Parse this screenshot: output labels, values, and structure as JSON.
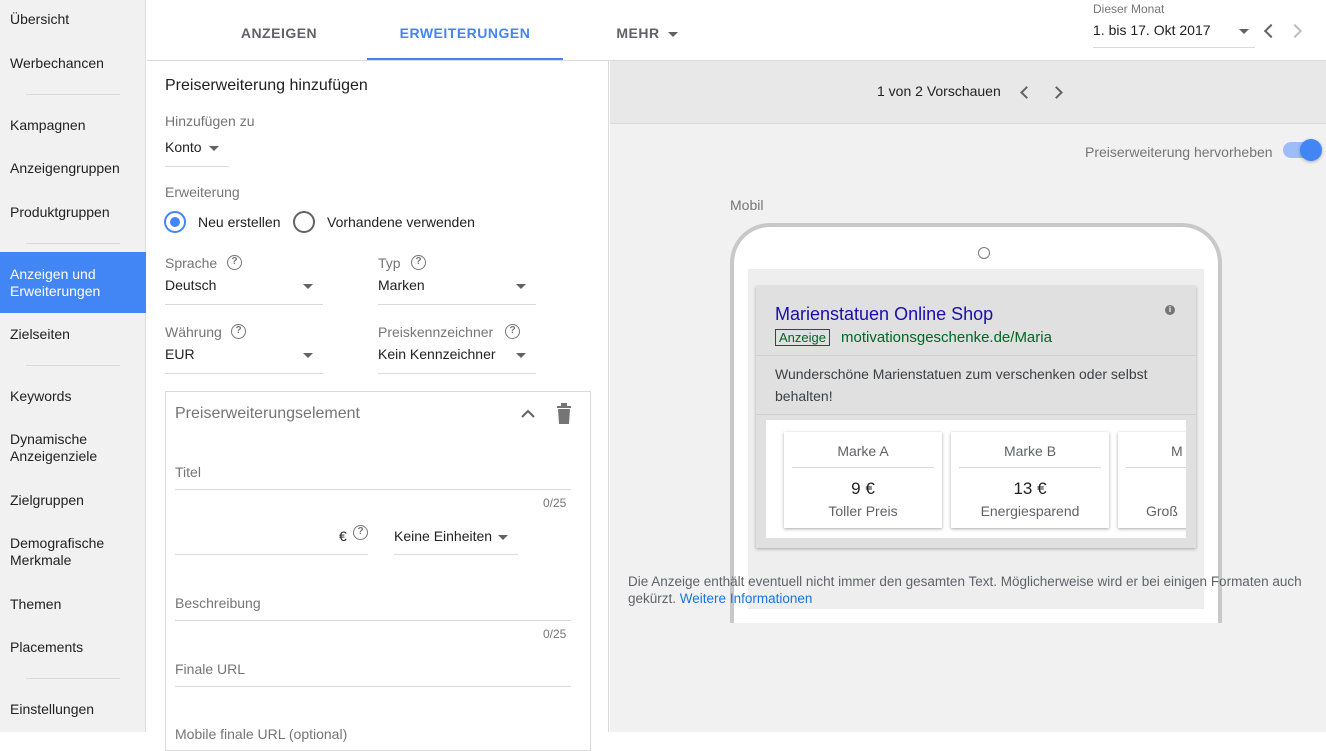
{
  "sidebar": {
    "items": [
      {
        "label": "Übersicht"
      },
      {
        "label": "Werbechancen"
      },
      {
        "label": "Kampagnen"
      },
      {
        "label": "Anzeigengruppen"
      },
      {
        "label": "Produktgruppen"
      },
      {
        "label": "Anzeigen und Erweiterungen",
        "active": true
      },
      {
        "label": "Zielseiten"
      },
      {
        "label": "Keywords"
      },
      {
        "label": "Dynamische Anzeigenziele"
      },
      {
        "label": "Zielgruppen"
      },
      {
        "label": "Demografische Merkmale"
      },
      {
        "label": "Themen"
      },
      {
        "label": "Placements"
      },
      {
        "label": "Einstellungen"
      }
    ]
  },
  "tabs": {
    "anzeigen": "ANZEIGEN",
    "erweiterungen": "ERWEITERUNGEN",
    "mehr": "MEHR"
  },
  "date_range": {
    "label": "Dieser Monat",
    "value": "1. bis 17. Okt 2017"
  },
  "form": {
    "title": "Preiserweiterung hinzufügen",
    "add_to_label": "Hinzufügen zu",
    "add_to_value": "Konto",
    "extension_label": "Erweiterung",
    "radio_new": "Neu erstellen",
    "radio_existing": "Vorhandene verwenden",
    "language_label": "Sprache",
    "language_value": "Deutsch",
    "type_label": "Typ",
    "type_value": "Marken",
    "currency_label": "Währung",
    "currency_value": "EUR",
    "qualifier_label": "Preiskennzeichner",
    "qualifier_value": "Kein Kennzeichner",
    "element": {
      "title": "Preiserweiterungselement",
      "field_title": "Titel",
      "title_counter": "0/25",
      "currency_symbol": "€",
      "unit_value": "Keine Einheiten",
      "field_description": "Beschreibung",
      "description_counter": "0/25",
      "field_final_url": "Finale URL",
      "field_mobile_url": "Mobile finale URL (optional)"
    }
  },
  "preview": {
    "pager": "1 von 2 Vorschauen",
    "highlight_label": "Preiserweiterung hervorheben",
    "highlight_on": true,
    "device_label": "Mobil",
    "ad": {
      "title": "Marienstatuen Online Shop",
      "badge": "Anzeige",
      "url": "motivationsgeschenke.de/Maria",
      "description": "Wunderschöne Marienstatuen zum verschenken oder selbst behalten!"
    },
    "price_cards": [
      {
        "header": "Marke A",
        "price": "9 €",
        "sub": "Toller Preis"
      },
      {
        "header": "Marke B",
        "price": "13 €",
        "sub": "Energiesparend"
      },
      {
        "header": "M",
        "price": "",
        "sub": "Groß"
      }
    ],
    "disclaimer": "Die Anzeige enthält eventuell nicht immer den gesamten Text. Möglicherweise wird er bei einigen Formaten auch gekürzt.",
    "more_info": "Weitere Informationen"
  },
  "colors": {
    "accent": "#4285f4",
    "ad_title": "#1a0dab",
    "ad_url": "#006621"
  },
  "icons": [
    "caret-down-icon",
    "chevron-left-icon",
    "chevron-right-icon",
    "help-icon",
    "chevron-up-icon",
    "trash-icon",
    "info-icon"
  ]
}
